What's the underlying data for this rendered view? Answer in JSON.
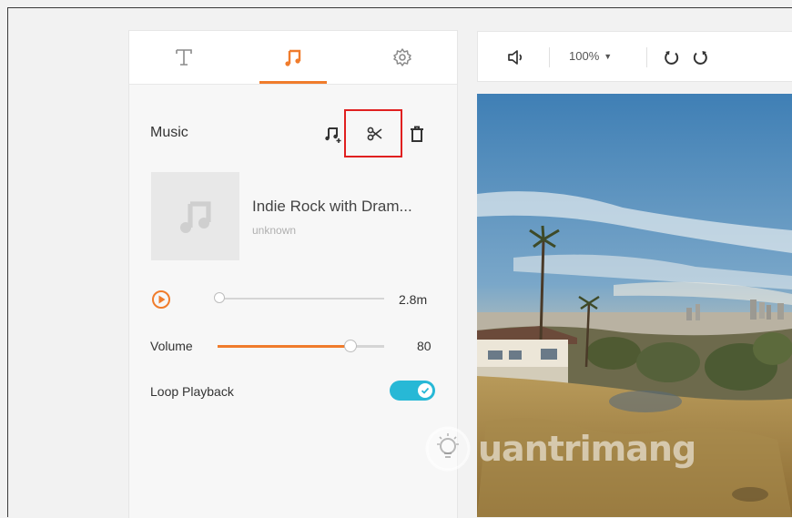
{
  "tabs": [
    {
      "id": "text",
      "icon": "text-icon",
      "active": false
    },
    {
      "id": "music",
      "icon": "music-note-icon",
      "active": true
    },
    {
      "id": "settings",
      "icon": "gear-icon",
      "active": false
    }
  ],
  "music": {
    "title": "Music",
    "tools": [
      "add-music-icon",
      "scissors-icon",
      "trash-icon"
    ]
  },
  "track": {
    "title": "Indie Rock with Dram...",
    "artist": "unknown",
    "duration": "2.8m",
    "progress_fraction": 0.0
  },
  "volume": {
    "label": "Volume",
    "value": "80",
    "level_fraction": 0.8
  },
  "loop": {
    "label": "Loop Playback",
    "enabled": true
  },
  "toolbar": {
    "zoom": "100%",
    "icons": [
      "speaker-icon",
      "undo-icon",
      "redo-icon"
    ]
  },
  "watermark": {
    "text": "uantrimang"
  },
  "colors": {
    "accent": "#f07c2c",
    "toggle": "#27b8d6",
    "highlight": "#e02020"
  }
}
